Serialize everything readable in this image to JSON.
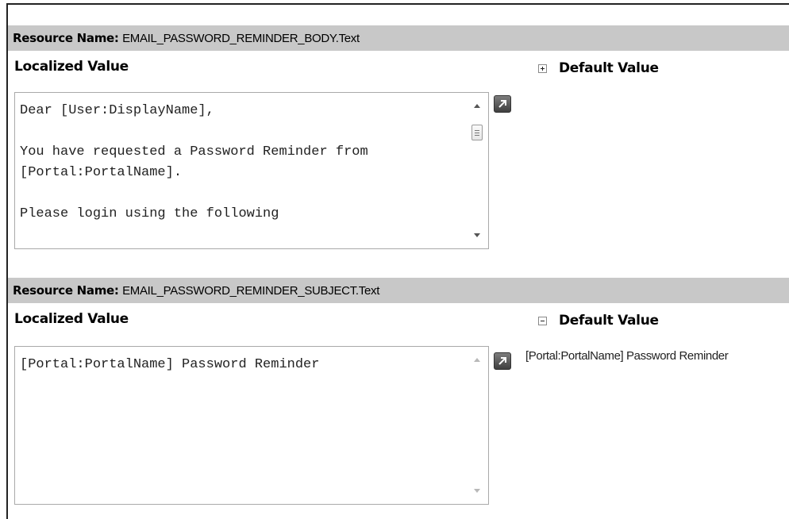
{
  "sections": [
    {
      "resource_label": "Resource Name:",
      "resource_name": "EMAIL_PASSWORD_REMINDER_BODY.Text",
      "localized_label": "Localized Value",
      "default_label": "Default Value",
      "expander": "plus-icon",
      "localized_value": "Dear [User:DisplayName],\n\nYou have requested a Password Reminder from [Portal:PortalName].\n\nPlease login using the following",
      "default_value": ""
    },
    {
      "resource_label": "Resource Name:",
      "resource_name": "EMAIL_PASSWORD_REMINDER_SUBJECT.Text",
      "localized_label": "Localized Value",
      "default_label": "Default Value",
      "expander": "minus-icon",
      "localized_value": "[Portal:PortalName] Password Reminder",
      "default_value": "[Portal:PortalName] Password Reminder"
    }
  ]
}
